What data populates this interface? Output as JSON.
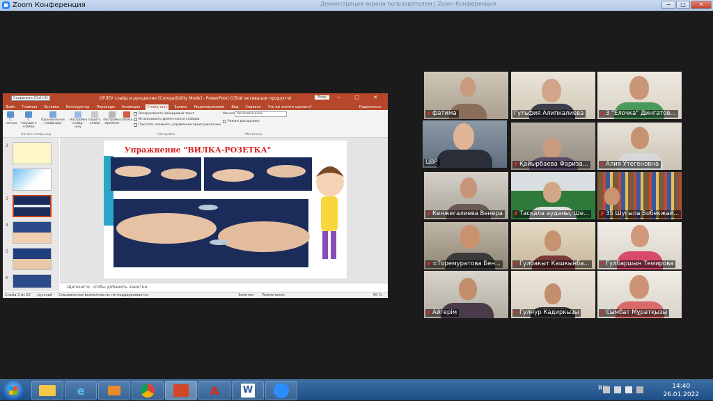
{
  "window": {
    "title": "Zoom Конференция",
    "ghost_title": "Демонстрация экрана пользователем | Zoom Конференция",
    "controls": [
      "−",
      "□",
      "✕"
    ]
  },
  "powerpoint": {
    "title": "ОРЛЕУ слайд и рукоделие [Compatibility Mode] - PowerPoint (Сбой активации продукта)",
    "save_tooltip": "Сохранить (Ctrl+S)",
    "login": "Вход",
    "tabs": [
      "Файл",
      "Главная",
      "Вставка",
      "Конструктор",
      "Переходы",
      "Анимация",
      "Слайд-шоу",
      "Запись",
      "Рецензирование",
      "Вид",
      "Справка"
    ],
    "active_tab": "Слайд-шоу",
    "help_prompt": "Что вы хотите сделать?",
    "share": "Поделиться",
    "ribbon": {
      "buttons": [
        "С начала",
        "С текущего слайда",
        "Произвольное слайд-шоу",
        "Настройка слайд-шоу",
        "Скрыть слайд",
        "Настройка времени",
        "Запись"
      ],
      "group_start": "Начать слайд-шоу",
      "group_setup": "Настройка",
      "group_monitors": "Мониторы",
      "checks": [
        "Воспроизвести закадровый текст",
        "Использовать время показа слайдов",
        "Показать элементы управления проигрывателем"
      ],
      "monitor_label": "Монитор:",
      "monitor_value": "Автоматически",
      "presenter_view": "Режим докладчика"
    },
    "thumbnail_numbers": [
      "2",
      "3",
      "4",
      "5",
      "6"
    ],
    "slide_title": "Упражнение \"ВИЛКА-РОЗЕТКА\"",
    "notes_placeholder": "Щелкните, чтобы добавить заметки",
    "status": {
      "slide": "Слайд 3 из 10",
      "language": "русский",
      "accessibility": "Специальные возможности: не поддерживается",
      "notes": "Заметки",
      "comments": "Примечания",
      "zoom": "60 %"
    }
  },
  "participants": [
    {
      "name": "фатима",
      "muted": true
    },
    {
      "name": "Гульфия Алипкалиева",
      "muted": false
    },
    {
      "name": "3 \"Ёлочка\" Дингатов...",
      "muted": true
    },
    {
      "name": "ЦВР",
      "muted": false,
      "speaking": true
    },
    {
      "name": "Қайырбаева Фариза...",
      "muted": true
    },
    {
      "name": "Алия Утегеновна",
      "muted": true
    },
    {
      "name": "Кенжегалиева Венера",
      "muted": true
    },
    {
      "name": "Тасқала ауданы, Ше...",
      "muted": true
    },
    {
      "name": "35 Шугыла Бобекжай...",
      "muted": true
    },
    {
      "name": "=Торемуратова Бен...",
      "muted": true
    },
    {
      "name": "Гулбакыт Кашкынба...",
      "muted": true
    },
    {
      "name": "Гулбаршын Темирова",
      "muted": true
    },
    {
      "name": "Айгерім",
      "muted": true
    },
    {
      "name": "Гулнур Кадиркызы",
      "muted": true
    },
    {
      "name": "Сымбат Мұратқызы",
      "muted": true
    }
  ],
  "taskbar": {
    "apps": [
      "explorer",
      "ie",
      "media-player",
      "chrome",
      "powerpoint",
      "acrobat",
      "word",
      "zoom"
    ],
    "language": "RU",
    "time": "14:40",
    "date": "26.01.2022"
  }
}
